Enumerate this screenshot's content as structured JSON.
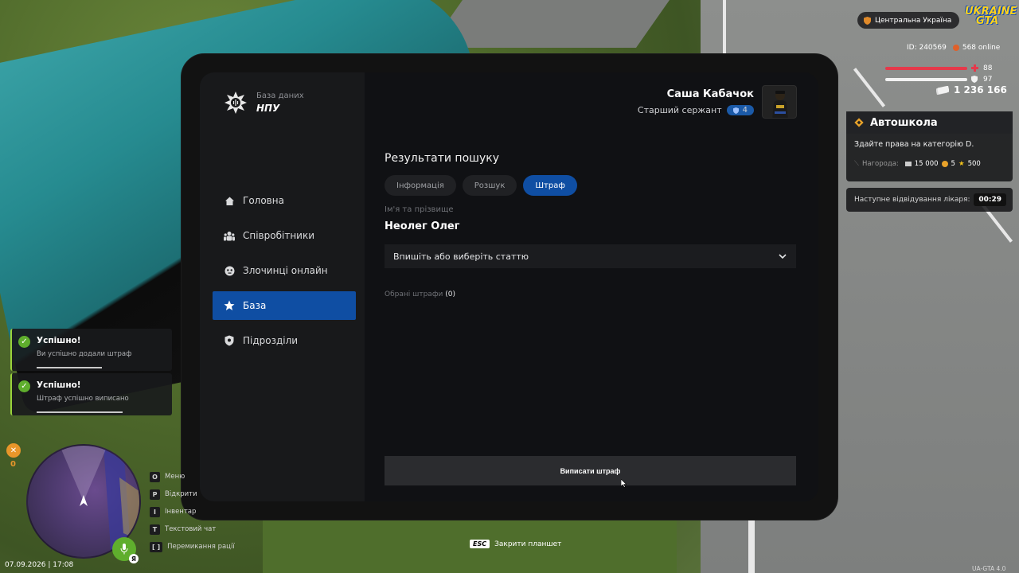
{
  "tablet": {
    "brand": {
      "subtitle": "База даних",
      "title": "НПУ"
    },
    "nav": [
      {
        "label": "Головна",
        "icon": "home-icon"
      },
      {
        "label": "Співробітники",
        "icon": "people-icon"
      },
      {
        "label": "Злочинці онлайн",
        "icon": "mask-icon"
      },
      {
        "label": "База",
        "icon": "star-icon",
        "active": true
      },
      {
        "label": "Підрозділи",
        "icon": "shield-icon"
      }
    ],
    "user": {
      "name": "Саша Кабачок",
      "rank": "Старший сержант",
      "rank_level": "4"
    },
    "main": {
      "title": "Результати пошуку",
      "tabs": [
        {
          "label": "Інформація"
        },
        {
          "label": "Розшук"
        },
        {
          "label": "Штраф",
          "active": true
        }
      ],
      "name_label": "Ім'я та прізвище",
      "person_name": "Неолег Олег",
      "article_select": "Впишіть або виберіть статтю",
      "selected_label": "Обрані штрафи",
      "selected_count": "(0)",
      "submit_label": "Виписати штраф"
    }
  },
  "hud": {
    "region": "Центральна Україна",
    "game_logo": [
      "UKRAINE",
      "GTA"
    ],
    "player_id": "ID: 240569",
    "online": "568 online",
    "health": 88,
    "armor": 97,
    "money": "1 236 166",
    "quest": {
      "title": "Автошкола",
      "description": "Здайте права на категорію D.",
      "reward_label": "Нагорода:",
      "reward_money": "15 000",
      "reward_coins": "5",
      "reward_stars": "500"
    },
    "doctor": {
      "label": "Наступне відвідування лікаря:",
      "time": "00:29"
    },
    "hunger": "0",
    "notifications": [
      {
        "title": "Успішно!",
        "text": "Ви успішно додали штраф"
      },
      {
        "title": "Успішно!",
        "text": "Штраф успішно виписано"
      }
    ],
    "keys": [
      {
        "key": "O",
        "label": "Меню"
      },
      {
        "key": "P",
        "label": "Відкрити"
      },
      {
        "key": "I",
        "label": "Інвентар"
      },
      {
        "key": "T",
        "label": "Текстовий чат"
      },
      {
        "key": "[ ]",
        "label": "Перемикання рації"
      }
    ],
    "datetime": "07.09.2026 | 17:08",
    "esc_key": "ESC",
    "esc_label": "Закрити планшет",
    "version": "UA-GTA 4.0",
    "voice_key": "Я"
  },
  "colors": {
    "accent": "#0f4ea3",
    "success": "#5fae2d",
    "health": "#e5394b"
  }
}
